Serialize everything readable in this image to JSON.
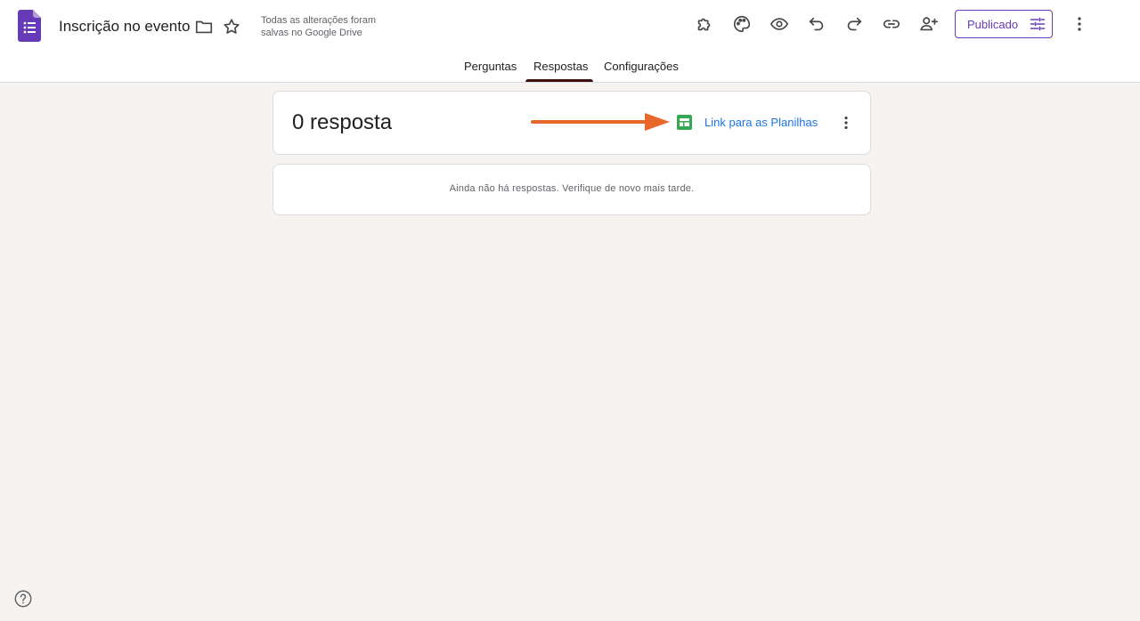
{
  "header": {
    "title": "Inscrição no evento",
    "save_status": "Todas as alterações foram salvas no Google Drive",
    "publish_label": "Publicado"
  },
  "tabs": [
    {
      "label": "Perguntas"
    },
    {
      "label": "Respostas"
    },
    {
      "label": "Configurações"
    }
  ],
  "active_tab": "Respostas",
  "responses": {
    "count_text": "0 resposta",
    "sheets_link": "Link para as Planilhas",
    "empty_message": "Ainda não há respostas. Verifique de novo mais tarde."
  },
  "colors": {
    "brand": "#673ab7",
    "link": "#1a73e8",
    "sheets": "#34a853",
    "annotation_arrow": "#e8672b",
    "background": "#f6f3f0"
  },
  "icons": [
    "forms-logo-icon",
    "folder-icon",
    "star-icon",
    "puzzle-icon",
    "palette-icon",
    "eye-icon",
    "undo-icon",
    "redo-icon",
    "link-icon",
    "add-person-icon",
    "tune-icon",
    "more-vert-icon",
    "sheets-icon",
    "help-icon"
  ]
}
